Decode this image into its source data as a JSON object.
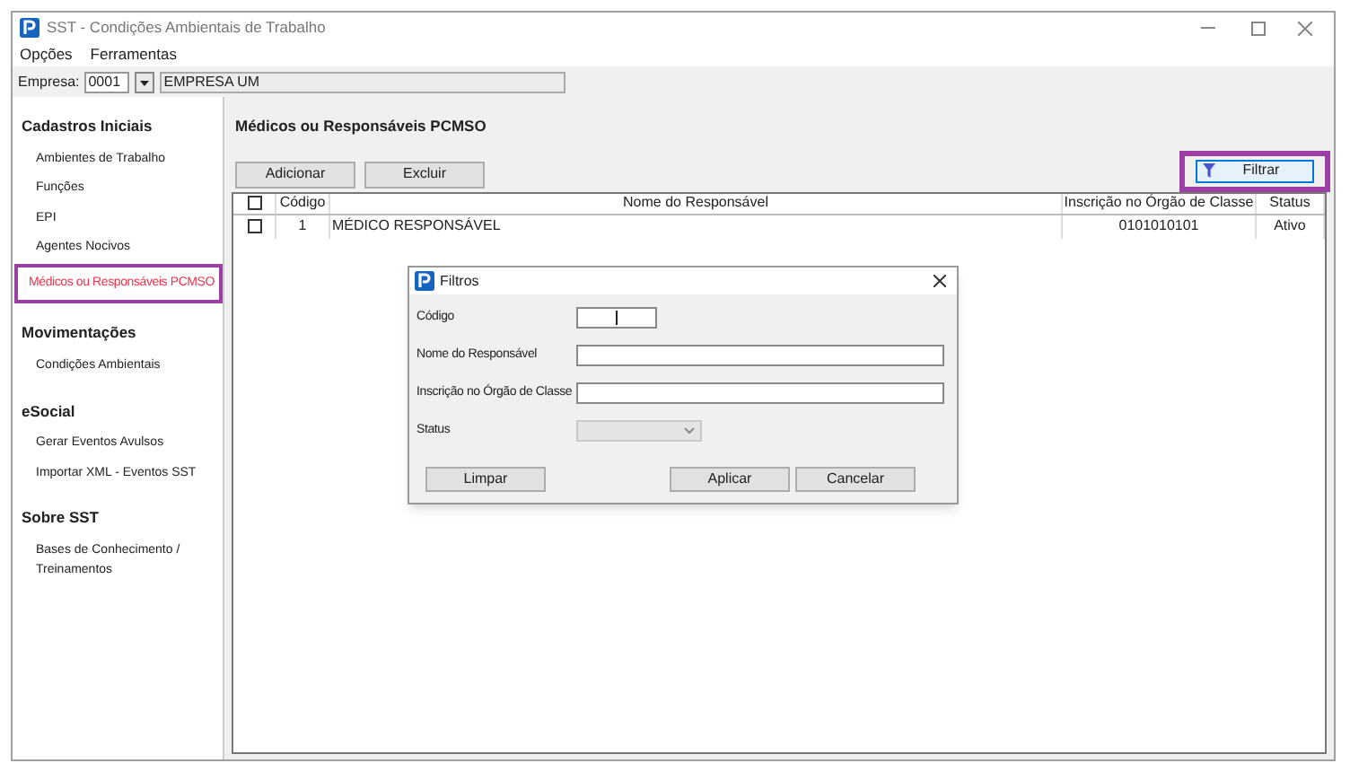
{
  "window": {
    "title": "SST - Condições Ambientais de Trabalho"
  },
  "menu": [
    "Opções",
    "Ferramentas"
  ],
  "company": {
    "label": "Empresa:",
    "code": "0001",
    "name": "EMPRESA UM"
  },
  "sidebar": [
    {
      "title": "Cadastros Iniciais",
      "items": [
        {
          "label": "Ambientes de Trabalho",
          "selected": false
        },
        {
          "label": "Funções",
          "selected": false
        },
        {
          "label": "EPI",
          "selected": false
        },
        {
          "label": "Agentes Nocivos",
          "selected": false
        },
        {
          "label": "Médicos ou Responsáveis PCMSO",
          "selected": true
        }
      ]
    },
    {
      "title": "Movimentações",
      "items": [
        {
          "label": "Condições Ambientais",
          "selected": false
        }
      ]
    },
    {
      "title": "eSocial",
      "items": [
        {
          "label": "Gerar Eventos Avulsos",
          "selected": false
        },
        {
          "label": "Importar XML - Eventos SST",
          "selected": false
        }
      ]
    },
    {
      "title": "Sobre SST",
      "items": [
        {
          "label": "Bases de Conhecimento / Treinamentos",
          "selected": false
        }
      ]
    }
  ],
  "page": {
    "title": "Médicos ou Responsáveis PCMSO",
    "buttons": [
      "Adicionar",
      "Excluir"
    ],
    "filter_button": "Filtrar"
  },
  "table": {
    "all_checked": false,
    "columns": [
      "Código",
      "Nome do Responsável",
      "Inscrição no Órgão de Classe",
      "Status"
    ],
    "rows": [
      {
        "checked": false,
        "cells": [
          "1",
          "MÉDICO RESPONSÁVEL",
          "0101010101",
          "Ativo"
        ]
      }
    ]
  },
  "dialog": {
    "title": "Filtros",
    "fields": [
      {
        "kind": "short",
        "label": "Código"
      },
      {
        "kind": "text",
        "label": "Nome do Responsável"
      },
      {
        "kind": "text",
        "label": "Inscrição no Órgão de Classe"
      },
      {
        "kind": "select",
        "label": "Status",
        "disabled": true
      }
    ],
    "buttons": [
      "Limpar",
      "Aplicar",
      "Cancelar"
    ]
  }
}
